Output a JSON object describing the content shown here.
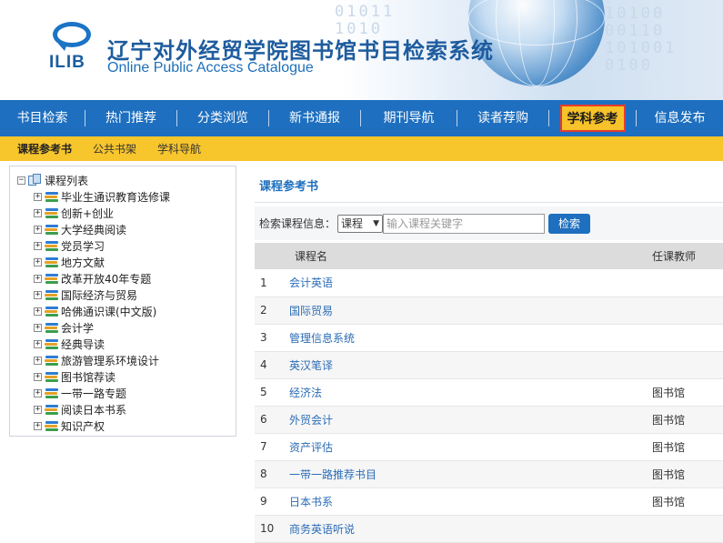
{
  "header": {
    "logo_text": "ILIB",
    "title": "辽宁对外经贸学院图书馆书目检索系统",
    "subtitle": "Online Public Access Catalogue"
  },
  "mainnav": {
    "items": [
      {
        "label": "书目检索",
        "active": false
      },
      {
        "label": "热门推荐",
        "active": false
      },
      {
        "label": "分类浏览",
        "active": false
      },
      {
        "label": "新书通报",
        "active": false
      },
      {
        "label": "期刊导航",
        "active": false
      },
      {
        "label": "读者荐购",
        "active": false
      },
      {
        "label": "学科参考",
        "active": true
      },
      {
        "label": "信息发布",
        "active": false
      }
    ]
  },
  "subnav": {
    "items": [
      {
        "label": "课程参考书",
        "active": true
      },
      {
        "label": "公共书架",
        "active": false
      },
      {
        "label": "学科导航",
        "active": false
      }
    ]
  },
  "tree": {
    "root_label": "课程列表",
    "items": [
      "毕业生通识教育选修课",
      "创新+创业",
      "大学经典阅读",
      "党员学习",
      "地方文献",
      "改革开放40年专题",
      "国际经济与贸易",
      "哈佛通识课(中文版)",
      "会计学",
      "经典导读",
      "旅游管理系环境设计",
      "图书馆荐读",
      "一带一路专题",
      "阅读日本书系",
      "知识产权"
    ]
  },
  "content": {
    "title": "课程参考书",
    "search_label": "检索课程信息：",
    "search_select_value": "课程",
    "search_placeholder": "输入课程关键字",
    "search_button": "检索",
    "table": {
      "headers": [
        "",
        "课程名",
        "任课教师"
      ],
      "rows": [
        {
          "num": "1",
          "name": "会计英语",
          "teacher": ""
        },
        {
          "num": "2",
          "name": "国际贸易",
          "teacher": ""
        },
        {
          "num": "3",
          "name": "管理信息系统",
          "teacher": ""
        },
        {
          "num": "4",
          "name": "英汉笔译",
          "teacher": ""
        },
        {
          "num": "5",
          "name": "经济法",
          "teacher": "图书馆"
        },
        {
          "num": "6",
          "name": "外贸会计",
          "teacher": "图书馆"
        },
        {
          "num": "7",
          "name": "资产评估",
          "teacher": "图书馆"
        },
        {
          "num": "8",
          "name": "一带一路推荐书目",
          "teacher": "图书馆"
        },
        {
          "num": "9",
          "name": "日本书系",
          "teacher": "图书馆"
        },
        {
          "num": "10",
          "name": "商务英语听说",
          "teacher": ""
        }
      ]
    }
  },
  "colors": {
    "nav_blue": "#1e6fbf",
    "subnav_yellow": "#f7c52c",
    "active_border": "#e53c2c",
    "link_blue": "#2b6cb5"
  }
}
